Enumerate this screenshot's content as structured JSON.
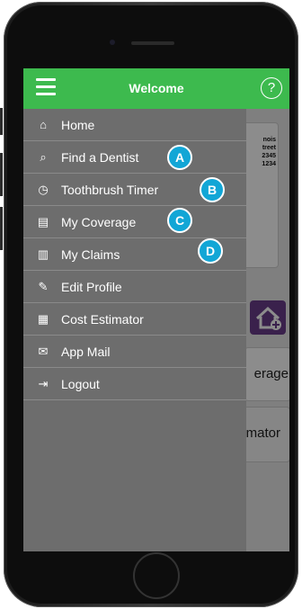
{
  "header": {
    "title": "Welcome",
    "menu_icon": "hamburger-icon",
    "help_glyph": "?"
  },
  "menu": {
    "items": [
      {
        "label": "Home",
        "icon": "home-icon",
        "glyph": "⌂"
      },
      {
        "label": "Find a Dentist",
        "icon": "search-icon",
        "glyph": "⌕"
      },
      {
        "label": "Toothbrush Timer",
        "icon": "stopwatch-icon",
        "glyph": "◷"
      },
      {
        "label": "My Coverage",
        "icon": "document-icon",
        "glyph": "▤"
      },
      {
        "label": "My Claims",
        "icon": "documents-icon",
        "glyph": "▥"
      },
      {
        "label": "Edit Profile",
        "icon": "edit-icon",
        "glyph": "✎"
      },
      {
        "label": "Cost Estimator",
        "icon": "calculator-icon",
        "glyph": "▦"
      },
      {
        "label": "App Mail",
        "icon": "mail-icon",
        "glyph": "✉"
      },
      {
        "label": "Logout",
        "icon": "logout-icon",
        "glyph": "⇥"
      }
    ]
  },
  "badges": [
    "A",
    "B",
    "C",
    "D"
  ],
  "background": {
    "address_lines": [
      "nois",
      "treet",
      "2345",
      "1234"
    ],
    "coverage_partial": "erage",
    "cost_estimator": "Cost Estimator"
  },
  "colors": {
    "topbar": "#3dba4e",
    "drawer": "#6d6d6d",
    "badge": "#12a6d6",
    "add_home": "#6a3d8a"
  }
}
